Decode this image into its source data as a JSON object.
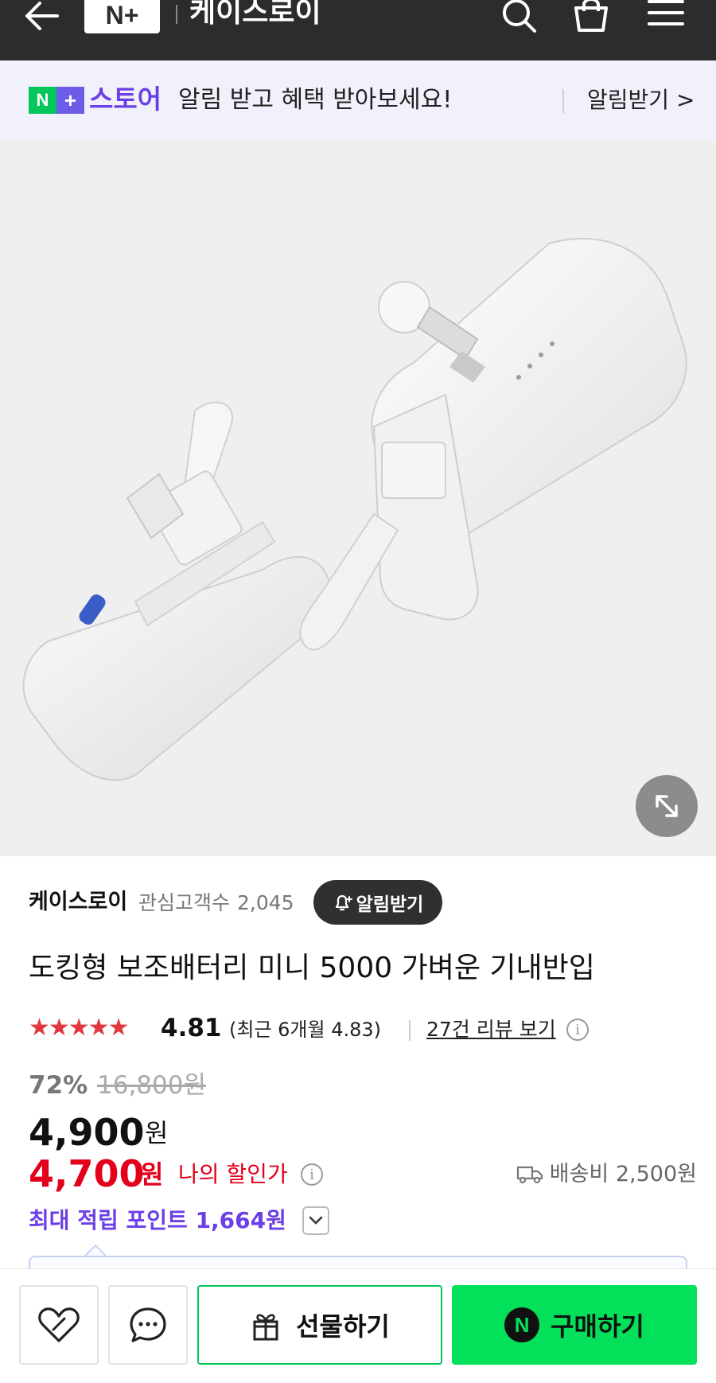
{
  "header": {
    "logo_text": "N+",
    "store_name": "케이스로이"
  },
  "banner": {
    "logo_n": "N",
    "logo_plus": "+",
    "store_label": "스토어",
    "message": "알림 받고 혜택 받아보세요!",
    "link_label": "알림받기 >"
  },
  "product": {
    "seller_name": "케이스로이",
    "follower_label": "관심고객수",
    "follower_count": "2,045",
    "notify_button_label": "알림받기",
    "title": "도킹형 보조배터리 미니 5000 가벼운 기내반입",
    "rating": {
      "stars": "★★★★★",
      "stars_value": 5,
      "score": "4.81",
      "recent": "(최근 6개월 4.83)",
      "review_link": "27건 리뷰 보기"
    },
    "price": {
      "discount_rate": "72%",
      "original_price": "16,800원",
      "sale_price": "4,900",
      "sale_unit": "원",
      "my_price": "4,700",
      "my_unit": "원",
      "my_price_label": "나의 할인가",
      "shipping": "배송비 2,500원"
    },
    "points": "최대 적립 포인트 1,664원"
  },
  "bottom_bar": {
    "gift_label": "선물하기",
    "buy_label": "구매하기",
    "buy_icon_letter": "N"
  },
  "colors": {
    "naver_green": "#03c75a",
    "buy_green": "#03e15a",
    "purple": "#6c3fe6",
    "red": "#e3001b",
    "star_red": "#e3373d",
    "header_dark": "#2b2c2e"
  }
}
